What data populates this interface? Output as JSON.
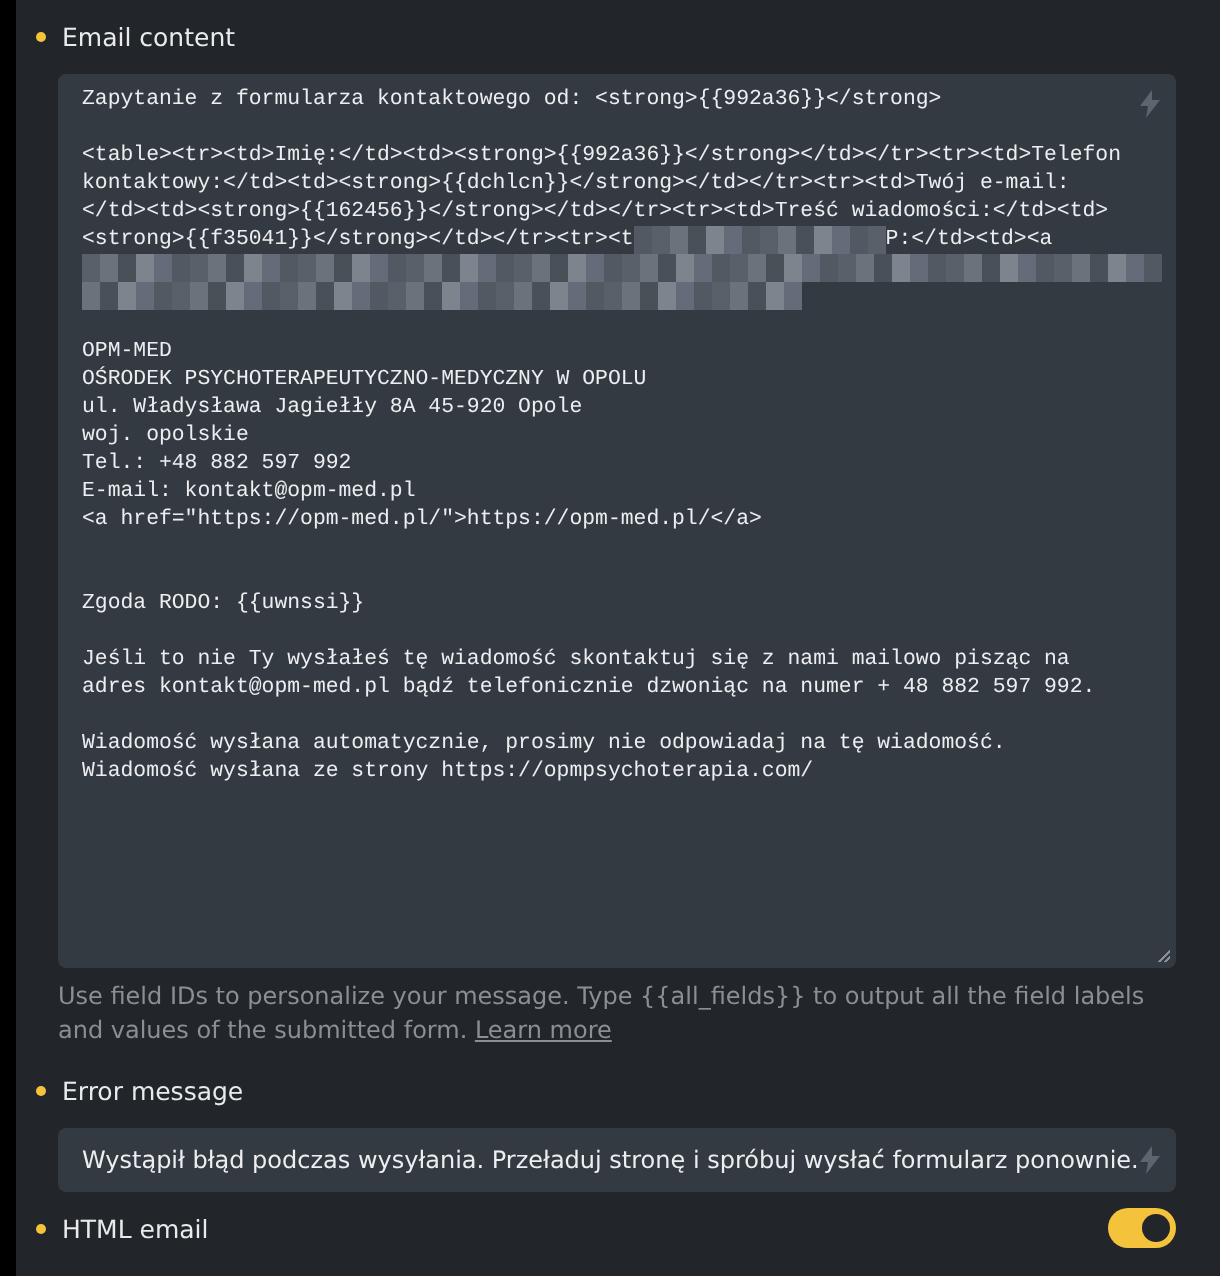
{
  "fields": [
    {
      "kind": "textarea",
      "label": "Email content",
      "lines": [
        {
          "kind": "text",
          "text": "Zapytanie z formularza kontaktowego od: <strong>{{992a36}}</strong>"
        },
        {
          "kind": "blank"
        },
        {
          "kind": "text",
          "text": "<table><tr><td>Imię:</td><td><strong>{{992a36}}</strong></td></tr><tr><td>Telefon"
        },
        {
          "kind": "text",
          "text": "kontaktowy:</td><td><strong>{{dchlcn}}</strong></td></tr><tr><td>Twój e-mail:"
        },
        {
          "kind": "text",
          "text": "</td><td><strong>{{162456}}</strong></td></tr><tr><td>Treść wiadomości:</td><td>"
        },
        {
          "kind": "partial",
          "parts": [
            "<strong>{{f35041}}</strong></td></tr><tr><t",
            "P:</td><td><a"
          ]
        },
        {
          "kind": "redacted"
        },
        {
          "kind": "redacted"
        },
        {
          "kind": "blank"
        },
        {
          "kind": "text",
          "text": "OPM-MED"
        },
        {
          "kind": "text",
          "text": "OŚRODEK PSYCHOTERAPEUTYCZNO-MEDYCZNY W OPOLU"
        },
        {
          "kind": "text",
          "text": "ul. Władysława Jagiełły 8A 45-920 Opole"
        },
        {
          "kind": "text",
          "text": "woj. opolskie"
        },
        {
          "kind": "text",
          "text": "Tel.: +48 882 597 992"
        },
        {
          "kind": "text",
          "text": "E-mail: kontakt@opm-med.pl"
        },
        {
          "kind": "text",
          "text": "<a href=\"https://opm-med.pl/\">https://opm-med.pl/</a>"
        },
        {
          "kind": "blank"
        },
        {
          "kind": "blank"
        },
        {
          "kind": "text",
          "text": "Zgoda RODO: {{uwnssi}}"
        },
        {
          "kind": "blank"
        },
        {
          "kind": "text",
          "text": "Jeśli to nie Ty wysłałeś tę wiadomość skontaktuj się z nami mailowo pisząc na"
        },
        {
          "kind": "text",
          "text": "adres kontakt@opm-med.pl bądź telefonicznie dzwoniąc na numer + 48 882 597 992."
        },
        {
          "kind": "blank"
        },
        {
          "kind": "text",
          "text": "Wiadomość wysłana automatycznie, prosimy nie odpowiadaj na tę wiadomość."
        },
        {
          "kind": "text",
          "text": "Wiadomość wysłana ze strony https://opmpsychoterapia.com/"
        }
      ],
      "help": "Use field IDs to personalize your message. Type {{all_fields}} to output all the field labels and values of the submitted form.",
      "help_link": "Learn more"
    },
    {
      "kind": "input",
      "label": "Error message",
      "value": "Wystąpił błąd podczas wysyłania. Przeładuj stronę i spróbuj wysłać formularz ponownie."
    },
    {
      "kind": "toggle",
      "label": "HTML email",
      "on": true
    }
  ]
}
